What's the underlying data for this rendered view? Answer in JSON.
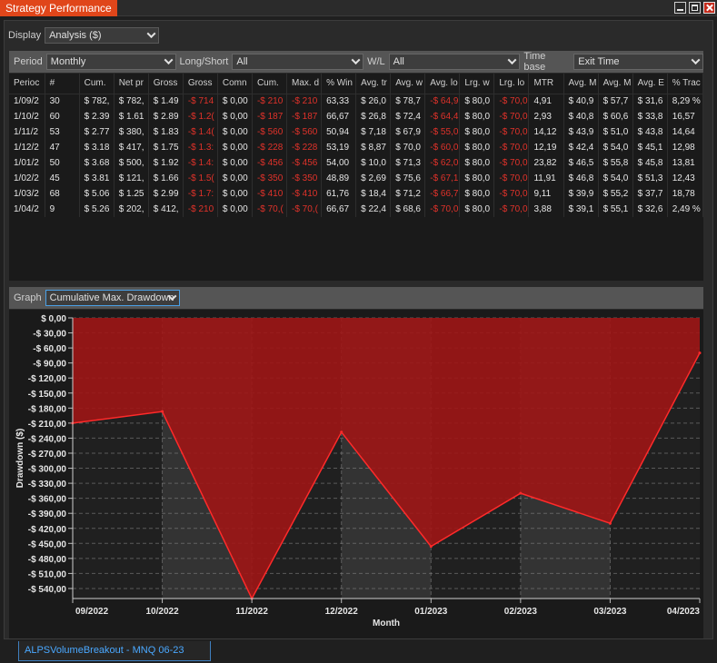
{
  "window": {
    "title": "Strategy Performance"
  },
  "display": {
    "label": "Display",
    "value": "Analysis ($)"
  },
  "filters": {
    "period_label": "Period",
    "period_value": "Monthly",
    "longshort_label": "Long/Short",
    "longshort_value": "All",
    "wl_label": "W/L",
    "wl_value": "All",
    "timebase_label": "Time base",
    "timebase_value": "Exit Time"
  },
  "table": {
    "headers": [
      "Perioc",
      "#",
      "Cum.",
      "Net pr",
      "Gross",
      "Gross",
      "Comn",
      "Cum.",
      "Max. d",
      "% Win",
      "Avg. tr",
      "Avg. w",
      "Avg. lo",
      "Lrg. w",
      "Lrg. lo",
      "MTR",
      "Avg. M",
      "Avg. M",
      "Avg. E",
      "% Trac"
    ],
    "rows": [
      [
        "1/09/2",
        "30",
        "$ 782,",
        "$ 782,",
        "$ 1.49",
        "-$ 714",
        "$ 0,00",
        "-$ 210",
        "-$ 210",
        "63,33",
        "$ 26,0",
        "$ 78,7",
        "-$ 64,9",
        "$ 80,0",
        "-$ 70,0",
        "4,91",
        "$ 40,9",
        "$ 57,7",
        "$ 31,6",
        "8,29 %"
      ],
      [
        "1/10/2",
        "60",
        "$ 2.39",
        "$ 1.61",
        "$ 2.89",
        "-$ 1.2(",
        "$ 0,00",
        "-$ 187",
        "-$ 187",
        "66,67",
        "$ 26,8",
        "$ 72,4",
        "-$ 64,4",
        "$ 80,0",
        "-$ 70,0",
        "2,93",
        "$ 40,8",
        "$ 60,6",
        "$ 33,8",
        "16,57"
      ],
      [
        "1/11/2",
        "53",
        "$ 2.77",
        "$ 380,",
        "$ 1.83",
        "-$ 1.4(",
        "$ 0,00",
        "-$ 560",
        "-$ 560",
        "50,94",
        "$ 7,18",
        "$ 67,9",
        "-$ 55,0",
        "$ 80,0",
        "-$ 70,0",
        "14,12",
        "$ 43,9",
        "$ 51,0",
        "$ 43,8",
        "14,64"
      ],
      [
        "1/12/2",
        "47",
        "$ 3.18",
        "$ 417,",
        "$ 1.75",
        "-$ 1.3:",
        "$ 0,00",
        "-$ 228",
        "-$ 228",
        "53,19",
        "$ 8,87",
        "$ 70,0",
        "-$ 60,0",
        "$ 80,0",
        "-$ 70,0",
        "12,19",
        "$ 42,4",
        "$ 54,0",
        "$ 45,1",
        "12,98"
      ],
      [
        "1/01/2",
        "50",
        "$ 3.68",
        "$ 500,",
        "$ 1.92",
        "-$ 1.4:",
        "$ 0,00",
        "-$ 456",
        "-$ 456",
        "54,00",
        "$ 10,0",
        "$ 71,3",
        "-$ 62,0",
        "$ 80,0",
        "-$ 70,0",
        "23,82",
        "$ 46,5",
        "$ 55,8",
        "$ 45,8",
        "13,81"
      ],
      [
        "1/02/2",
        "45",
        "$ 3.81",
        "$ 121,",
        "$ 1.66",
        "-$ 1.5(",
        "$ 0,00",
        "-$ 350",
        "-$ 350",
        "48,89",
        "$ 2,69",
        "$ 75,6",
        "-$ 67,1",
        "$ 80,0",
        "-$ 70,0",
        "11,91",
        "$ 46,8",
        "$ 54,0",
        "$ 51,3",
        "12,43"
      ],
      [
        "1/03/2",
        "68",
        "$ 5.06",
        "$ 1.25",
        "$ 2.99",
        "-$ 1.7:",
        "$ 0,00",
        "-$ 410",
        "-$ 410",
        "61,76",
        "$ 18,4",
        "$ 71,2",
        "-$ 66,7",
        "$ 80,0",
        "-$ 70,0",
        "9,11",
        "$ 39,9",
        "$ 55,2",
        "$ 37,7",
        "18,78"
      ],
      [
        "1/04/2",
        "9",
        "$ 5.26",
        "$ 202,",
        "$ 412,",
        "-$ 210",
        "$ 0,00",
        "-$ 70,(",
        "-$ 70,(",
        "66,67",
        "$ 22,4",
        "$ 68,6",
        "-$ 70,0",
        "$ 80,0",
        "-$ 70,0",
        "3,88",
        "$ 39,1",
        "$ 55,1",
        "$ 32,6",
        "2,49 %"
      ]
    ]
  },
  "graph": {
    "label": "Graph",
    "value": "Cumulative Max. Drawdown"
  },
  "chart_data": {
    "type": "area",
    "xlabel": "Month",
    "ylabel": "Drawdown ($)",
    "categories": [
      "09/2022",
      "10/2022",
      "11/2022",
      "12/2022",
      "01/2023",
      "02/2023",
      "03/2023",
      "04/2023"
    ],
    "values": [
      -210,
      -187,
      -560,
      -228,
      -456,
      -350,
      -410,
      -70
    ],
    "ylim": [
      -560,
      0
    ],
    "yticks": [
      0,
      -30,
      -60,
      -90,
      -120,
      -150,
      -180,
      -210,
      -240,
      -270,
      -300,
      -330,
      -360,
      -390,
      -420,
      -450,
      -480,
      -510,
      -540
    ],
    "ytick_labels": [
      "$ 0,00",
      "-$ 30,00",
      "-$ 60,00",
      "-$ 90,00",
      "-$ 120,00",
      "-$ 150,00",
      "-$ 180,00",
      "-$ 210,00",
      "-$ 240,00",
      "-$ 270,00",
      "-$ 300,00",
      "-$ 330,00",
      "-$ 360,00",
      "-$ 390,00",
      "-$ 420,00",
      "-$ 450,00",
      "-$ 480,00",
      "-$ 510,00",
      "-$ 540,00"
    ],
    "grid": true,
    "fill_color": "#a01414",
    "line_color": "#ff2a2a",
    "stripe_colors": [
      "#202020",
      "#333333"
    ]
  },
  "bottom_tab": {
    "label": "ALPSVolumeBreakout - MNQ 06-23"
  },
  "colors": {
    "accent": "#e0461a",
    "negative": "#e0322a",
    "tab_text": "#4aa8ff"
  }
}
